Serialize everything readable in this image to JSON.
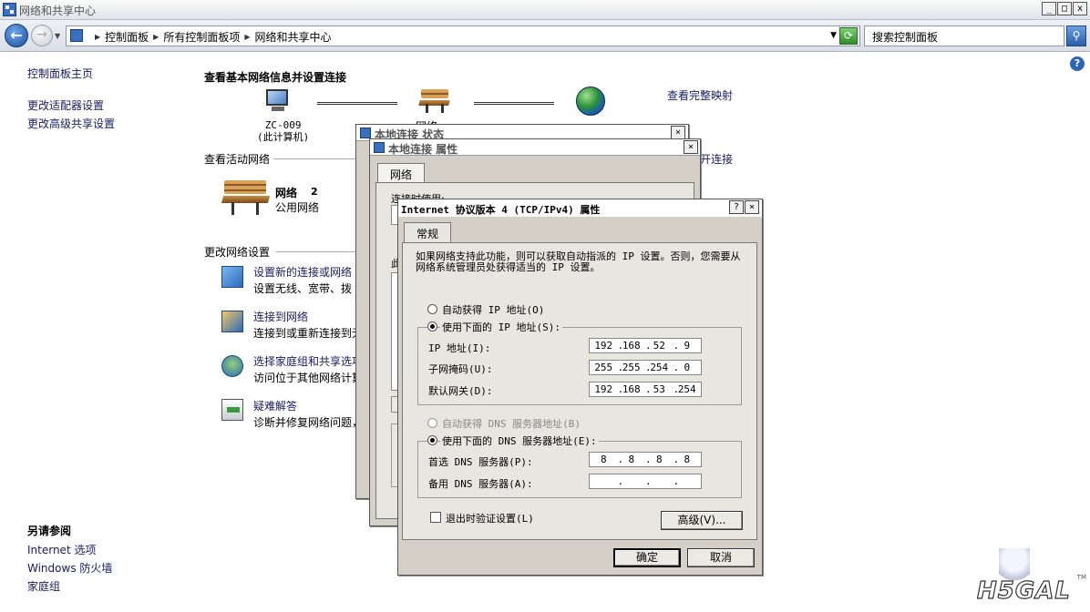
{
  "window": {
    "title": "网络和共享中心",
    "buttons": [
      "_",
      "□",
      "x"
    ]
  },
  "address": {
    "crumbs": [
      "控制面板",
      "所有控制面板项",
      "网络和共享中心"
    ],
    "search_placeholder": "搜索控制面板"
  },
  "sidebar": {
    "home": "控制面板主页",
    "links": [
      "更改适配器设置",
      "更改高级共享设置"
    ],
    "see_also_title": "另请参阅",
    "see_also": [
      "Internet 选项",
      "Windows 防火墙",
      "家庭组"
    ]
  },
  "main": {
    "heading": "查看基本网络信息并设置连接",
    "view_full_map": "查看完整映射",
    "computer_name": "ZC-009",
    "computer_label": "(此计算机)",
    "network_partial_label": "网络",
    "active_networks_title": "查看活动网络",
    "connect_partial": "开连接",
    "network": {
      "name": "网络",
      "count": "2",
      "type": "公用网络"
    },
    "change_settings_title": "更改网络设置",
    "tasks": [
      {
        "title": "设置新的连接或网络",
        "desc": "设置无线、宽带、拨"
      },
      {
        "title": "连接到网络",
        "desc": "连接到或重新连接到无"
      },
      {
        "title": "选择家庭组和共享选项",
        "desc": "访问位于其他网络计算"
      },
      {
        "title": "疑难解答",
        "desc": "诊断并修复网络问题，"
      }
    ]
  },
  "status_dialog": {
    "title": "本地连接 状态"
  },
  "props_dialog": {
    "title": "本地连接 属性",
    "tab": "网络",
    "connect_using": "连接时使用:",
    "partial_label": "此"
  },
  "ipv4_dialog": {
    "title": "Internet 协议版本 4 (TCP/IPv4) 属性",
    "help_btn": "?",
    "close_btn": "×",
    "tab": "常规",
    "description": "如果网络支持此功能，则可以获取自动指派的 IP 设置。否则，您需要从网络系统管理员处获得适当的 IP 设置。",
    "auto_ip": "自动获得 IP 地址(O)",
    "manual_ip": "使用下面的 IP 地址(S):",
    "ip_label": "IP 地址(I):",
    "ip": [
      "192",
      "168",
      "52",
      "9"
    ],
    "mask_label": "子网掩码(U):",
    "mask": [
      "255",
      "255",
      "254",
      "0"
    ],
    "gateway_label": "默认网关(D):",
    "gateway": [
      "192",
      "168",
      "53",
      "254"
    ],
    "auto_dns": "自动获得 DNS 服务器地址(B)",
    "manual_dns": "使用下面的 DNS 服务器地址(E):",
    "pref_dns_label": "首选 DNS 服务器(P):",
    "pref_dns": [
      "8",
      "8",
      "8",
      "8"
    ],
    "alt_dns_label": "备用 DNS 服务器(A):",
    "alt_dns": [
      "",
      "",
      "",
      ""
    ],
    "validate_label": "退出时验证设置(L)",
    "advanced_btn": "高级(V)...",
    "ok_btn": "确定",
    "cancel_btn": "取消"
  },
  "watermark": {
    "text": "H5GAL",
    "tm": "TM"
  }
}
